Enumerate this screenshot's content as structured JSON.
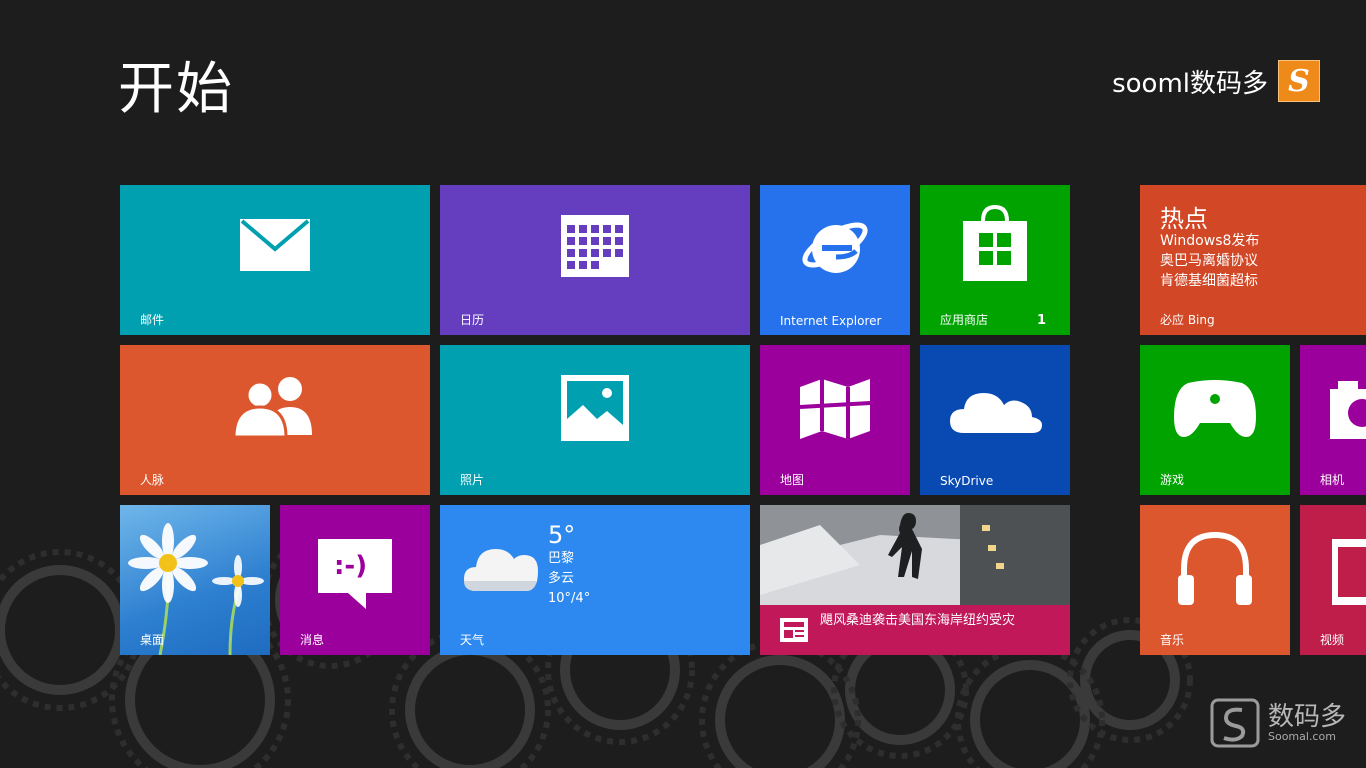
{
  "start": {
    "title": "开始"
  },
  "user": {
    "name": "sooml数码多",
    "avatar_letter": "S"
  },
  "tiles": {
    "mail": {
      "label": "邮件",
      "color": "#00a0b1"
    },
    "calendar": {
      "label": "日历",
      "color": "#643ebf"
    },
    "ie": {
      "label": "Internet Explorer",
      "color": "#2672ec"
    },
    "store": {
      "label": "应用商店",
      "badge": "1",
      "color": "#00a300"
    },
    "hot": {
      "label": "必应 Bing",
      "title": "热点",
      "items": [
        "Windows8发布",
        "奥巴马离婚协议",
        "肯德基细菌超标"
      ],
      "color": "#d24726"
    },
    "people": {
      "label": "人脉",
      "color": "#dc572e"
    },
    "photos": {
      "label": "照片",
      "color": "#00a0b1"
    },
    "maps": {
      "label": "地图",
      "color": "#9c009c"
    },
    "skydrive": {
      "label": "SkyDrive",
      "color": "#094ab2"
    },
    "games": {
      "label": "游戏",
      "color": "#00a300"
    },
    "camera": {
      "label": "相机",
      "color": "#9c009c"
    },
    "desktop": {
      "label": "桌面"
    },
    "messaging": {
      "label": "消息",
      "color": "#9c009c",
      "icon_text": ":-)"
    },
    "weather": {
      "label": "天气",
      "temp": "5°",
      "city": "巴黎",
      "condition": "多云",
      "range": "10°/4°",
      "color": "#2d89ef"
    },
    "news": {
      "headline": "飓风桑迪袭击美国东海岸纽约受灾",
      "color": "#c1185a"
    },
    "music": {
      "label": "音乐",
      "color": "#dc572e"
    },
    "video": {
      "label": "视频",
      "color": "#bf1e4b"
    }
  },
  "watermark": {
    "name": "数码多",
    "url": "Soomal.com"
  }
}
